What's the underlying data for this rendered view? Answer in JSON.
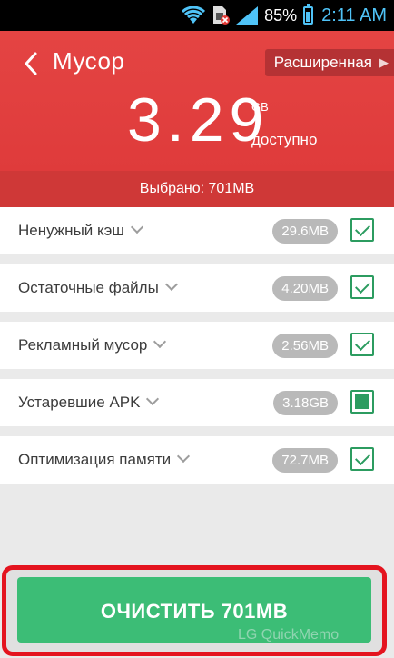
{
  "status_bar": {
    "battery_percent": "85%",
    "time": "2:11 AM",
    "icons": [
      "wifi-icon",
      "sim-card-blocked-icon",
      "signal-icon",
      "battery-charging-icon"
    ]
  },
  "header": {
    "title": "Мусор",
    "advanced_label": "Расширенная",
    "amount": "3.29",
    "unit": "GB",
    "available_label": "доступно",
    "selected_label": "Выбрано: 701MB"
  },
  "items": [
    {
      "label": "Ненужный кэш",
      "size": "29.6MB",
      "state": "checked"
    },
    {
      "label": "Остаточные файлы",
      "size": "4.20MB",
      "state": "checked"
    },
    {
      "label": "Рекламный мусор",
      "size": "2.56MB",
      "state": "checked"
    },
    {
      "label": "Устаревшие APK",
      "size": "3.18GB",
      "state": "partial"
    },
    {
      "label": "Оптимизация памяти",
      "size": "72.7MB",
      "state": "checked"
    }
  ],
  "clean_button_label": "ОЧИСТИТЬ 701MB",
  "watermark": "LG QuickMemo",
  "colors": {
    "header": "#e44443",
    "header_dark": "#cf3837",
    "accent_green": "#3cbd76",
    "checkbox_green": "#2c9c60",
    "highlight_frame": "#e4141f"
  }
}
